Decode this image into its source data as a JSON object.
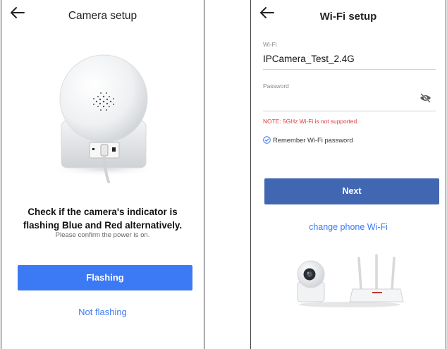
{
  "left_screen": {
    "title": "Camera setup",
    "instruction": "Check if the camera's indicator is flashing Blue and Red alternatively.",
    "hint": "Please confirm the power is on.",
    "primary_button": "Flashing",
    "secondary_link": "Not flashing"
  },
  "right_screen": {
    "title": "Wi-Fi setup",
    "wifi_label": "Wi-Fi",
    "wifi_value": "IPCamera_Test_2.4G",
    "password_label": "Password",
    "password_value": "",
    "note": "NOTE: 5GHz Wi-Fi is not supported.",
    "remember_label": "Remember Wi-Fi password",
    "remember_checked": true,
    "next_button": "Next",
    "change_wifi_link": "change phone Wi-Fi"
  },
  "colors": {
    "primary_blue": "#3b79f5",
    "next_blue": "#4267b2",
    "note_red": "#e0393c"
  },
  "icons": [
    "back-arrow-icon",
    "eye-off-icon",
    "check-circle-icon"
  ]
}
